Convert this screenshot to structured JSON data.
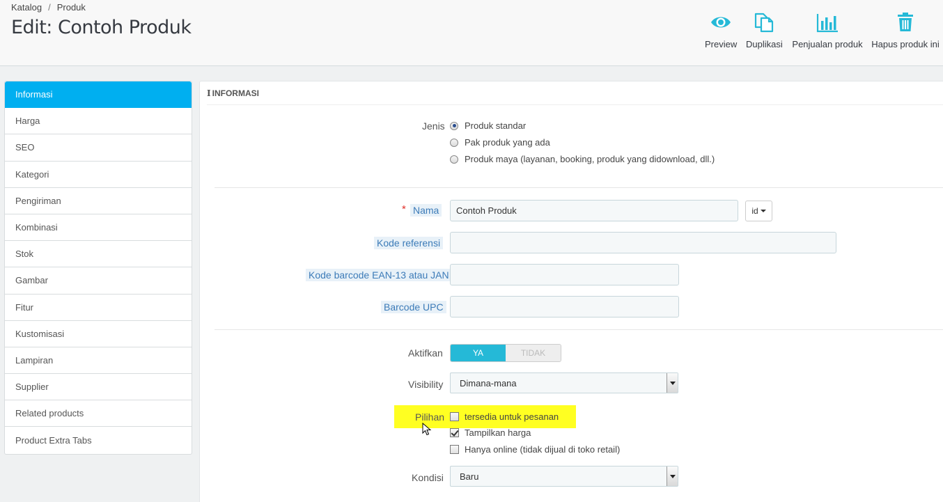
{
  "breadcrumb": {
    "item1": "Katalog",
    "separator": "/",
    "item2": "Produk"
  },
  "page_title": "Edit: Contoh Produk",
  "toolbar": [
    {
      "label": "Preview",
      "icon": "eye-icon"
    },
    {
      "label": "Duplikasi",
      "icon": "copy-icon"
    },
    {
      "label": "Penjualan produk",
      "icon": "bar-chart-icon"
    },
    {
      "label": "Hapus produk ini",
      "icon": "trash-icon"
    }
  ],
  "sidebar": {
    "items": [
      {
        "label": "Informasi",
        "active": true
      },
      {
        "label": "Harga"
      },
      {
        "label": "SEO"
      },
      {
        "label": "Kategori"
      },
      {
        "label": "Pengiriman"
      },
      {
        "label": "Kombinasi"
      },
      {
        "label": "Stok"
      },
      {
        "label": "Gambar"
      },
      {
        "label": "Fitur"
      },
      {
        "label": "Kustomisasi"
      },
      {
        "label": "Lampiran"
      },
      {
        "label": "Supplier"
      },
      {
        "label": "Related products"
      },
      {
        "label": "Product Extra Tabs"
      }
    ]
  },
  "panel": {
    "heading": "INFORMASI",
    "jenis": {
      "label": "Jenis",
      "options": [
        {
          "label": "Produk standar",
          "selected": true
        },
        {
          "label": "Pak produk yang ada",
          "selected": false
        },
        {
          "label": "Produk maya (layanan, booking, produk yang didownload, dll.)",
          "selected": false
        }
      ]
    },
    "nama": {
      "label": "Nama",
      "required_mark": "*",
      "value": "Contoh Produk",
      "lang": "id"
    },
    "kode_referensi": {
      "label": "Kode referensi",
      "value": ""
    },
    "ean13": {
      "label": "Kode barcode EAN-13 atau JAN",
      "value": ""
    },
    "upc": {
      "label": "Barcode UPC",
      "value": ""
    },
    "aktifkan": {
      "label": "Aktifkan",
      "yes": "YA",
      "no": "TIDAK",
      "value": "YA"
    },
    "visibility": {
      "label": "Visibility",
      "value": "Dimana-mana"
    },
    "pilihan": {
      "label": "Pilihan",
      "options": [
        {
          "label": "tersedia untuk pesanan",
          "checked": false
        },
        {
          "label": "Tampilkan harga",
          "checked": true
        },
        {
          "label": "Hanya online (tidak dijual di toko retail)",
          "checked": false
        }
      ]
    },
    "kondisi": {
      "label": "Kondisi",
      "value": "Baru"
    }
  },
  "colors": {
    "accent": "#00aff0",
    "switch_on": "#25b9d7",
    "highlight": "#ffff22",
    "icon": "#25b9d7"
  }
}
